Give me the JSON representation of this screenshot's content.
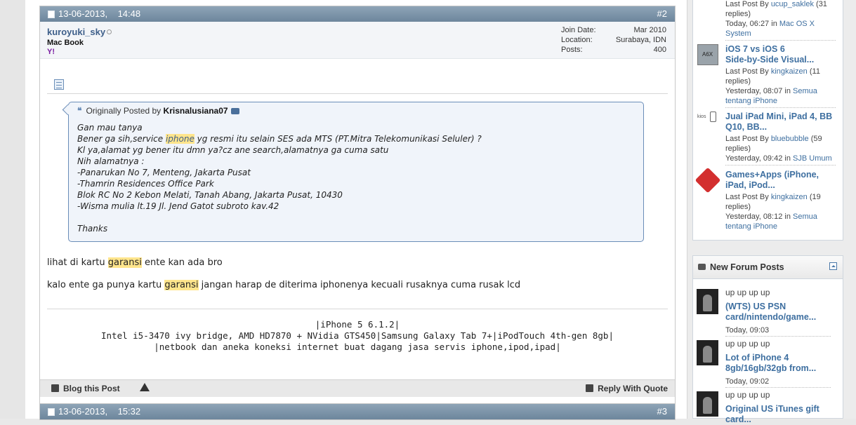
{
  "post2": {
    "date": "13-06-2013,",
    "time": "14:48",
    "number": "#2",
    "username": "kuroyuki_sky",
    "usertitle": "Mac Book",
    "yahoo": "Y!",
    "join_date_label": "Join Date:",
    "join_date": "Mar 2010",
    "location_label": "Location:",
    "location": "Surabaya, IDN",
    "posts_label": "Posts:",
    "posts": "400",
    "quote": {
      "prefix": "Originally Posted by",
      "author": "Krisnalusiana07",
      "l1": "Gan mau tanya",
      "l2a": "Bener ga sih,service ",
      "l2hl": "iphone",
      "l2b": " yg resmi itu selain SES ada MTS (PT.Mitra Telekomunikasi Seluler) ?",
      "l3": "Kl ya,alamat yg bener itu dmn ya?cz ane search,alamatnya ga cuma satu",
      "l4": "Nih alamatnya :",
      "l5": "-Panarukan No 7, Menteng, Jakarta Pusat",
      "l6": "-Thamrin Residences Office Park",
      "l7": "Blok RC No 2 Kebon Melati, Tanah Abang, Jakarta Pusat, 10430",
      "l8": "-Wisma mulia lt.19 Jl. Jend Gatot subroto kav.42",
      "l9": "Thanks"
    },
    "msg1a": "lihat di kartu ",
    "msg1hl": "garansi",
    "msg1b": " ente kan ada bro",
    "msg2a": "kalo ente ga punya kartu ",
    "msg2hl": "garansi",
    "msg2b": " jangan harap de diterima iphonenya kecuali rusaknya cuma rusak lcd",
    "sig1": "|iPhone 5 6.1.2|",
    "sig2": "Intel i5-3470 ivy bridge, AMD HD7870 + NVidia GTS450|Samsung Galaxy Tab 7+|iPodTouch 4th-gen 8gb|",
    "sig3": "|netbook dan aneka koneksi internet buat dagang jasa servis iphone,ipod,ipad|",
    "blog_label": "Blog this Post",
    "reply_label": "Reply With Quote"
  },
  "post3": {
    "date": "13-06-2013,",
    "time": "15:32",
    "number": "#3"
  },
  "sidebar_threads": [
    {
      "title": "",
      "meta1a": "Last Post By ",
      "meta1link": "ucup_saklek",
      "meta1b": " (31",
      "meta2": "replies)",
      "meta3a": "Today, 06:27",
      "meta3b": " in ",
      "meta3link": "Mac OS X",
      "meta4": "System"
    },
    {
      "title1": "iOS 7 vs iOS 6",
      "title2": "Side-by-Side Visual...",
      "meta1a": "Last Post By ",
      "meta1link": "kingkaizen",
      "meta1b": " (11",
      "meta2": "replies)",
      "meta3a": "Yesterday, 08:07",
      "meta3b": " in ",
      "meta3link": "Semua",
      "meta4": "tentang iPhone",
      "thumb_text": "A6X"
    },
    {
      "title1": "Jual iPad Mini, iPad 4, BB",
      "title2": "Q10, BB...",
      "meta1a": "Last Post By ",
      "meta1link": "bluebubble",
      "meta1b": " (59",
      "meta2": "replies)",
      "meta3a": "Yesterday, 09:42",
      "meta3b": " in ",
      "meta3link": "SJB Umum",
      "thumb_text": "kios"
    },
    {
      "title1": "Games+Apps (iPhone,",
      "title2": "iPad, iPod...",
      "meta1a": "Last Post By ",
      "meta1link": "kingkaizen",
      "meta1b": " (19",
      "meta2": "replies)",
      "meta3a": "Yesterday, 08:12",
      "meta3b": " in ",
      "meta3link": "Semua",
      "meta4": "tentang iPhone"
    }
  ],
  "new_forum_posts": {
    "heading": "New Forum Posts",
    "items": [
      {
        "snippet": "up up up up",
        "title1": "(WTS) US PSN",
        "title2": "card/nintendo/game...",
        "time": "Today, 09:03"
      },
      {
        "snippet": "up up up up",
        "title1": "Lot of iPhone 4",
        "title2": "8gb/16gb/32gb from...",
        "time": "Today, 09:02"
      },
      {
        "snippet": "up up up up",
        "title1": "Original US iTunes gift",
        "title2": "card..."
      }
    ]
  },
  "colors": {
    "header_bar": "#6d869c",
    "link": "#3e6fa0",
    "highlight": "#ffe58c",
    "quote_border": "#6a8db8"
  }
}
